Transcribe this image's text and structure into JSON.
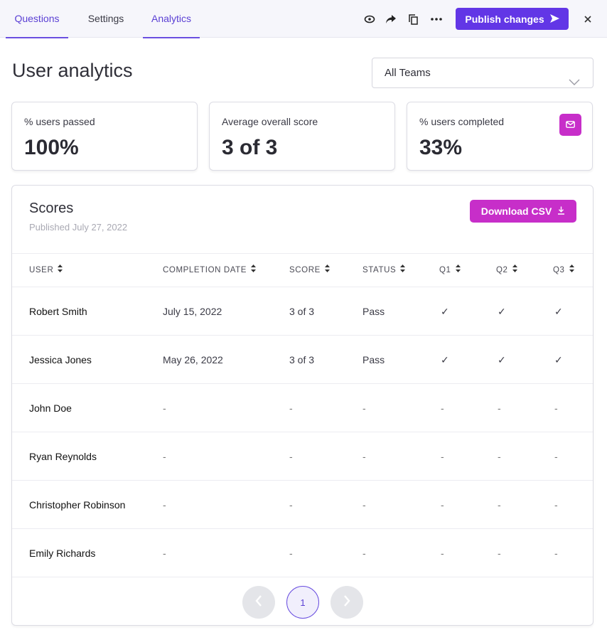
{
  "tabs": [
    {
      "label": "Questions",
      "active": true
    },
    {
      "label": "Settings",
      "active": false
    },
    {
      "label": "Analytics",
      "active": true
    }
  ],
  "toolbar": {
    "icons": [
      "eye-icon",
      "share-icon",
      "copy-icon",
      "more-icon"
    ],
    "publish_label": "Publish changes",
    "close_icon": "close-icon"
  },
  "page": {
    "title": "User analytics",
    "team_filter": "All Teams"
  },
  "stats": [
    {
      "label": "% users passed",
      "value": "100%"
    },
    {
      "label": "Average overall score",
      "value": "3 of 3"
    },
    {
      "label": "% users completed",
      "value": "33%"
    }
  ],
  "scores": {
    "title": "Scores",
    "published": "Published July 27, 2022",
    "download_label": "Download CSV",
    "columns": [
      "USER",
      "COMPLETION DATE",
      "SCORE",
      "STATUS",
      "Q1",
      "Q2",
      "Q3"
    ],
    "rows": [
      {
        "user": "Robert Smith",
        "date": "July 15, 2022",
        "score": "3 of 3",
        "status": "Pass",
        "q1": "✓",
        "q2": "✓",
        "q3": "✓"
      },
      {
        "user": "Jessica Jones",
        "date": "May 26, 2022",
        "score": "3 of 3",
        "status": "Pass",
        "q1": "✓",
        "q2": "✓",
        "q3": "✓"
      },
      {
        "user": "John Doe",
        "date": "-",
        "score": "-",
        "status": "-",
        "q1": "-",
        "q2": "-",
        "q3": "-"
      },
      {
        "user": "Ryan Reynolds",
        "date": "-",
        "score": "-",
        "status": "-",
        "q1": "-",
        "q2": "-",
        "q3": "-"
      },
      {
        "user": "Christopher Robinson",
        "date": "-",
        "score": "-",
        "status": "-",
        "q1": "-",
        "q2": "-",
        "q3": "-"
      },
      {
        "user": "Emily Richards",
        "date": "-",
        "score": "-",
        "status": "-",
        "q1": "-",
        "q2": "-",
        "q3": "-"
      }
    ]
  },
  "pagination": {
    "current_page": "1"
  },
  "colors": {
    "primary": "#6236e6",
    "accent": "#c72ec9",
    "tab_active": "#5a3fd4"
  }
}
